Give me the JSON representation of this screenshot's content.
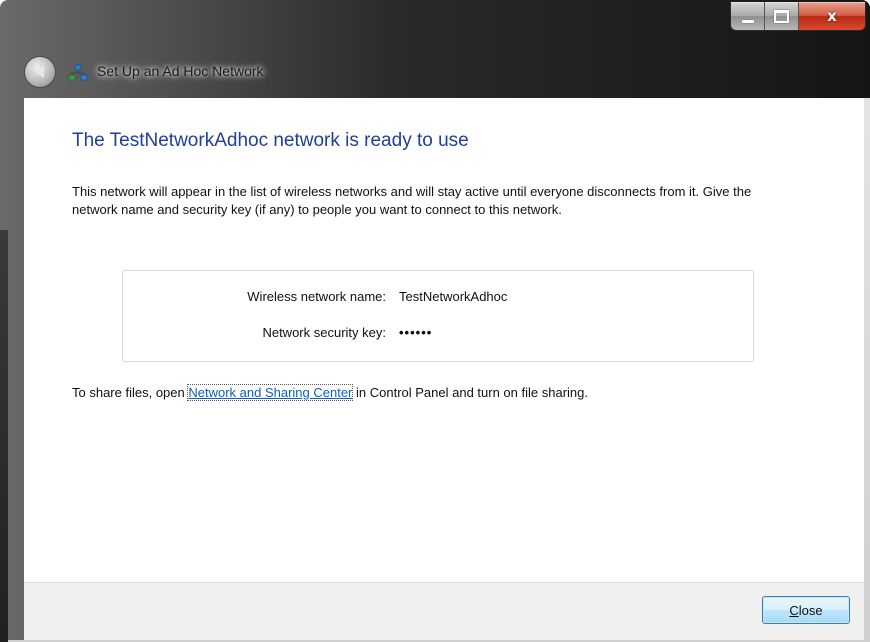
{
  "window": {
    "title": "Set Up an Ad Hoc Network",
    "controls": {
      "minimize": "",
      "maximize": "",
      "close": "x"
    }
  },
  "main": {
    "heading": "The TestNetworkAdhoc network is ready to use",
    "description": "This network will appear in the list of wireless networks and will stay active until everyone disconnects from it. Give the network name and security key (if any) to people you want to connect to this network.",
    "network_name_label": "Wireless network name:",
    "network_name_value": "TestNetworkAdhoc",
    "security_key_label": "Network security key:",
    "security_key_value": "••••••",
    "share_prefix": "To share files, open ",
    "share_link": "Network and Sharing Center",
    "share_suffix": " in Control Panel and turn on file sharing."
  },
  "footer": {
    "close_accel": "C",
    "close_rest": "lose"
  },
  "icons": {
    "back": "back-arrow-icon",
    "title": "network-icon"
  },
  "colors": {
    "heading": "#1e3f9a",
    "link": "#0b5fbd",
    "close_button_border": "#3c7fb1"
  }
}
